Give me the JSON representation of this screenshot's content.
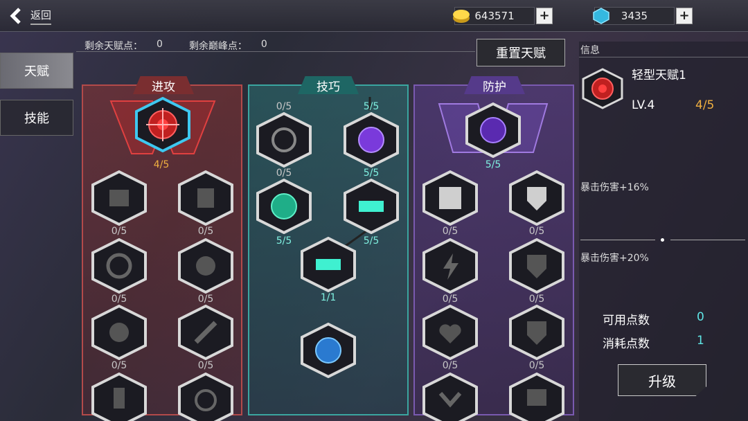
{
  "top": {
    "back_label": "返回",
    "gold": "643571",
    "gem": "3435",
    "plus": "+"
  },
  "tabs": [
    {
      "label": "天赋"
    },
    {
      "label": "技能"
    }
  ],
  "points": {
    "talent_label": "剩余天赋点：",
    "talent_value": "0",
    "peak_label": "剩余巅峰点：",
    "peak_value": "0"
  },
  "reset_label": "重置天赋",
  "columns": {
    "offense": "进攻",
    "skill": "技巧",
    "defense": "防护"
  },
  "levels": {
    "off_top": "4/5",
    "off_r1a": "0/5",
    "off_r1b": "0/5",
    "off_r2a": "0/5",
    "off_r2b": "0/5",
    "off_r3a": "0/5",
    "off_r3b": "0/5",
    "skl_a": "0/5",
    "skl_b": "5/5",
    "skl_c": "0/5",
    "skl_d": "5/5",
    "skl_e": "5/5",
    "skl_f": "5/5",
    "skl_g": "1/1",
    "def_top": "5/5",
    "def_r1a": "0/5",
    "def_r1b": "0/5",
    "def_r2a": "0/5",
    "def_r2b": "0/5",
    "def_r3a": "0/5",
    "def_r3b": "0/5"
  },
  "info": {
    "title": "信息",
    "talent_name": "轻型天赋1",
    "level": "LV.4",
    "progress": "4/5",
    "effect_current": "暴击伤害+16%",
    "effect_next": "暴击伤害+20%",
    "available_label": "可用点数",
    "available_value": "0",
    "cost_label": "消耗点数",
    "cost_value": "1",
    "upgrade_label": "升级"
  },
  "colors": {
    "offense": "#b34a4a",
    "skill": "#3aa6a0",
    "defense": "#7a5ab0",
    "gold_text": "#f0b040",
    "teal_text": "#7ff0e0"
  },
  "icons": [
    "back-arrow-icon",
    "gold-coin-icon",
    "blue-gem-icon",
    "crosshair-icon",
    "rocket-icon",
    "shield-icon",
    "turret-icon",
    "wheel-icon"
  ]
}
